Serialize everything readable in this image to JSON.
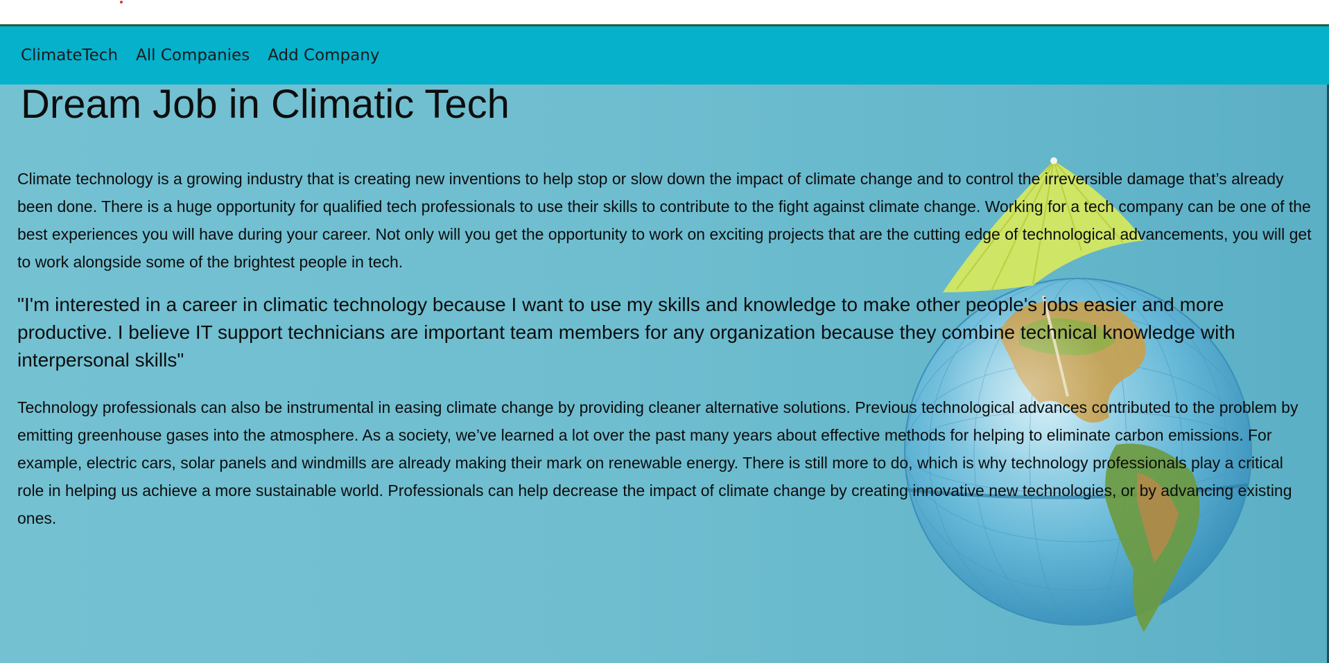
{
  "nav": {
    "brand": "ClimateTech",
    "links": [
      "All Companies",
      "Add Company"
    ]
  },
  "main": {
    "title": "Dream Job in Climatic Tech",
    "paragraph1": "Climate technology is a growing industry that is creating new inventions to help stop or slow down the impact of climate change and to control the irreversible damage that’s already been done. There is a huge opportunity for qualified tech professionals to use their skills to contribute to the fight against climate change. Working for a tech company can be one of the best experiences you will have during your career. Not only will you get the opportunity to work on exciting projects that are the cutting edge of technological advancements, you will get to work alongside some of the brightest people in tech.",
    "quote": "\"I'm interested in a career in climatic technology because I want to use my skills and knowledge to make other people's jobs easier and more productive. I believe IT support technicians are important team members for any organization because they combine technical knowledge with interpersonal skills\"",
    "paragraph2": "Technology professionals can also be instrumental in easing climate change by providing cleaner alternative solutions. Previous technological advances contributed to the problem by emitting greenhouse gases into the atmosphere. As a society, we’ve learned a lot over the past many years about effective methods for helping to eliminate carbon emissions. For example, electric cars, solar panels and windmills are already making their mark on renewable energy. There is still more to do, which is why technology professionals play a critical role in helping us achieve a more sustainable world. Professionals can help decrease the impact of climate change by creating innovative new technologies, or by advancing existing ones."
  },
  "background": {
    "icon": "globe-with-cocktail-umbrella-image",
    "colors": {
      "navbar": "#06b1cc",
      "backdrop": "#6fbed0",
      "accent_line": "#1e5e3e"
    }
  }
}
